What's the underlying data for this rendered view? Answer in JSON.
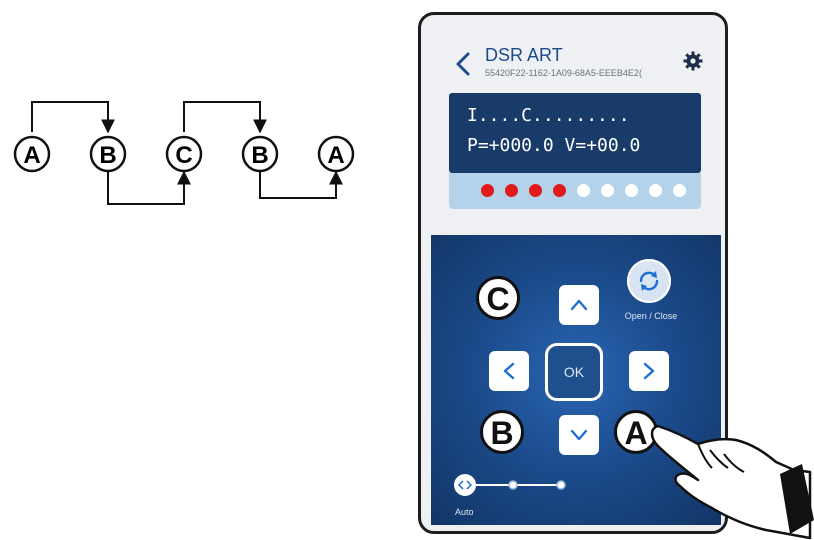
{
  "diagram": {
    "nodes": [
      "A",
      "B",
      "C",
      "B",
      "A"
    ]
  },
  "app": {
    "title": "DSR ART",
    "device_id": "55420F22-1162-1A09-68A5-EEEB4E2(",
    "lcd": {
      "line1": "I....C.........",
      "line2": "P=+000.0 V=+00.0"
    },
    "leds": [
      "red",
      "red",
      "red",
      "red",
      "white",
      "white",
      "white",
      "white",
      "white"
    ],
    "colors": {
      "led_on": "#e01b1b",
      "led_off": "#ffffff",
      "panel": "#183b69",
      "accent": "#1b4b8a"
    },
    "buttons": {
      "ok": "OK",
      "open_close": "Open / Close"
    },
    "slider": {
      "label": "Auto",
      "positions": 3,
      "selected": 0
    },
    "callouts": {
      "up_left": "C",
      "down_left": "B",
      "down_right": "A"
    }
  }
}
